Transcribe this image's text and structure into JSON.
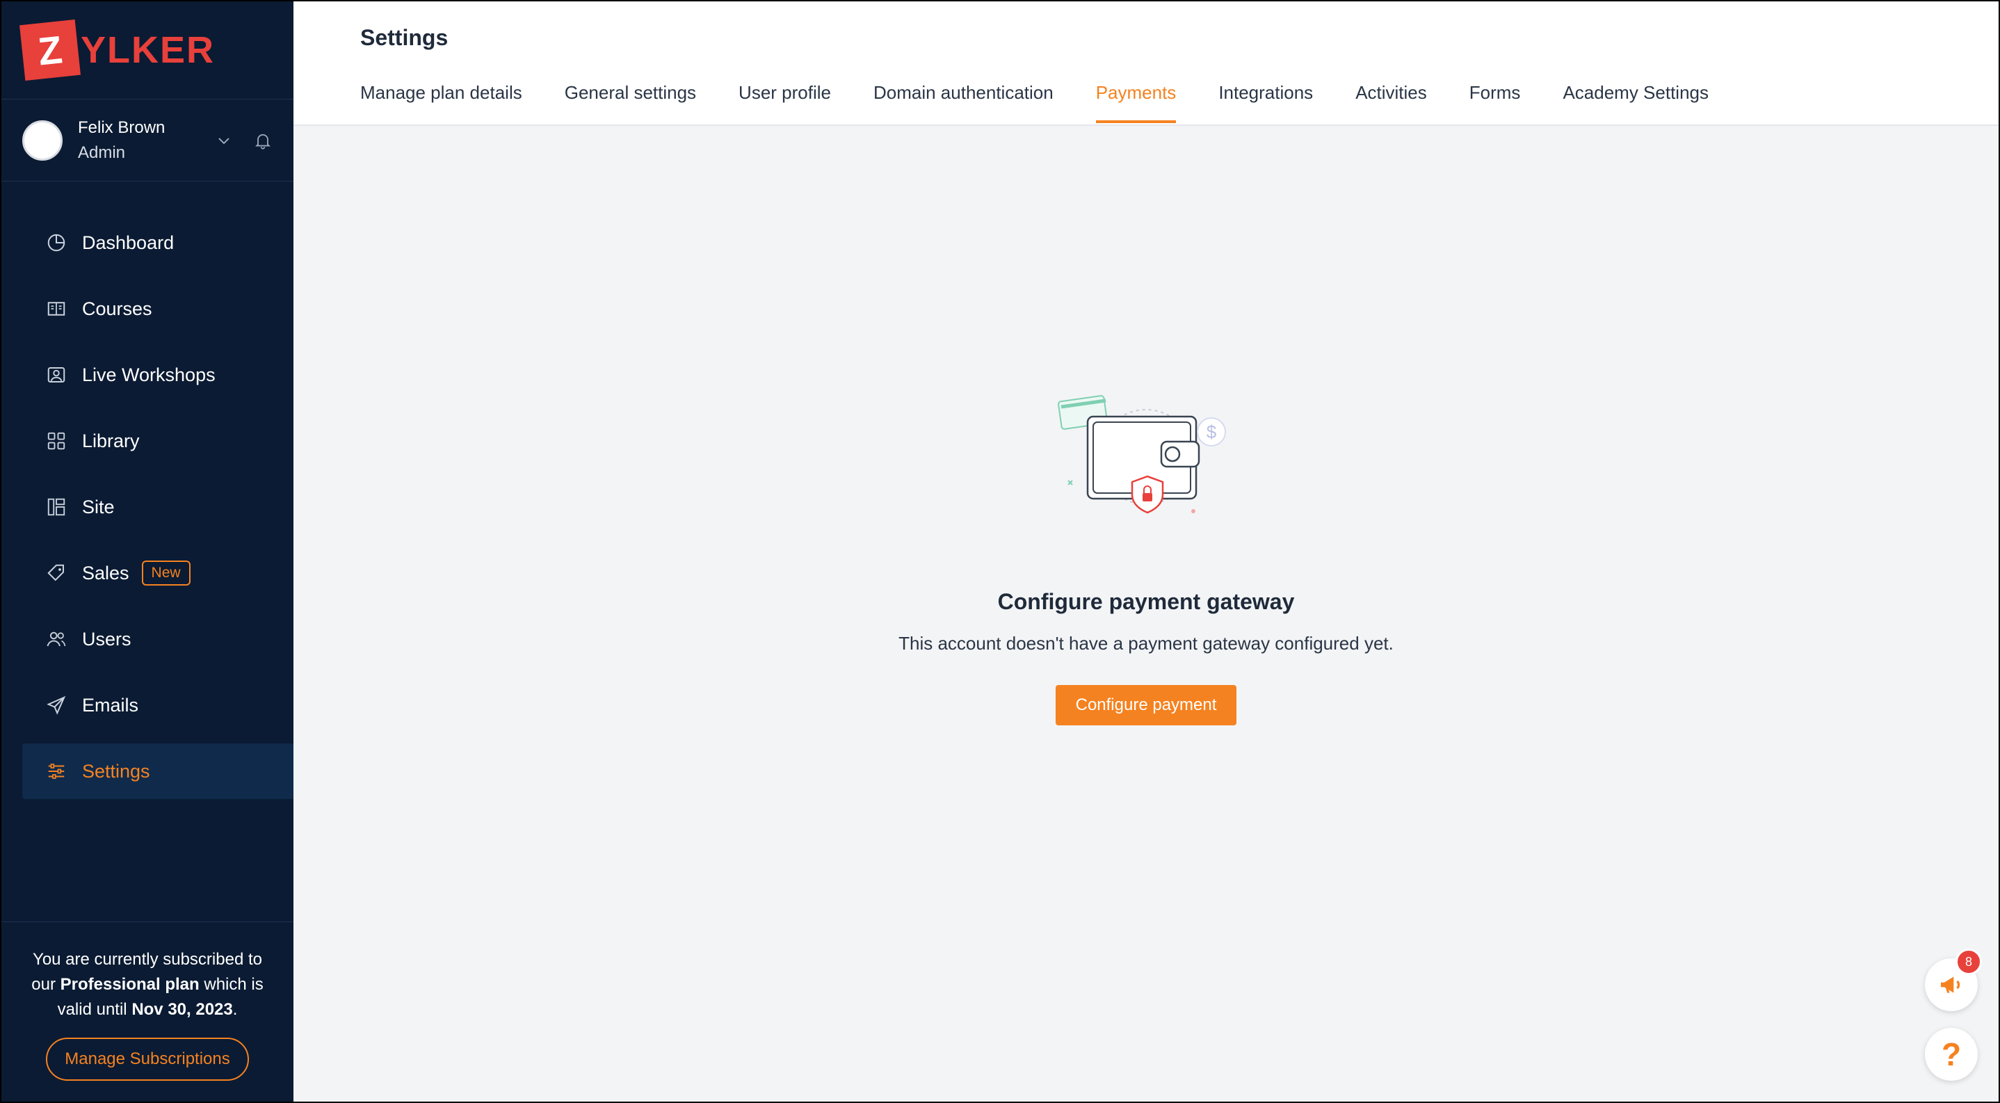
{
  "brand": {
    "logo_letter": "Z",
    "logo_text": "YLKER"
  },
  "user": {
    "name": "Felix Brown",
    "role": "Admin"
  },
  "nav": [
    {
      "label": "Dashboard",
      "icon": "dashboard-icon"
    },
    {
      "label": "Courses",
      "icon": "courses-icon"
    },
    {
      "label": "Live Workshops",
      "icon": "live-workshops-icon"
    },
    {
      "label": "Library",
      "icon": "library-icon"
    },
    {
      "label": "Site",
      "icon": "site-icon"
    },
    {
      "label": "Sales",
      "icon": "sales-tag-icon",
      "badge": "New"
    },
    {
      "label": "Users",
      "icon": "users-icon"
    },
    {
      "label": "Emails",
      "icon": "emails-icon"
    },
    {
      "label": "Settings",
      "icon": "settings-sliders-icon",
      "active": true
    }
  ],
  "subscription": {
    "line1": "You are currently subscribed to",
    "line2_prefix": "our ",
    "plan": "Professional plan",
    "line2_suffix": " which is",
    "line3_prefix": "valid until ",
    "valid_until": "Nov 30, 2023",
    "line3_suffix": ".",
    "manage_label": "Manage Subscriptions"
  },
  "page": {
    "title": "Settings"
  },
  "tabs": [
    {
      "label": "Manage plan details"
    },
    {
      "label": "General settings"
    },
    {
      "label": "User profile"
    },
    {
      "label": "Domain authentication"
    },
    {
      "label": "Payments",
      "active": true
    },
    {
      "label": "Integrations"
    },
    {
      "label": "Activities"
    },
    {
      "label": "Forms"
    },
    {
      "label": "Academy Settings"
    }
  ],
  "empty_state": {
    "illustration": "wallet-icon",
    "title": "Configure payment gateway",
    "subtitle": "This account doesn't have a payment gateway configured yet.",
    "button": "Configure payment"
  },
  "widgets": {
    "announcement_count": "8",
    "help_glyph": "?"
  },
  "colors": {
    "accent": "#f58220",
    "sidebar_bg": "#0b1b33",
    "brand_red": "#e8403b"
  }
}
